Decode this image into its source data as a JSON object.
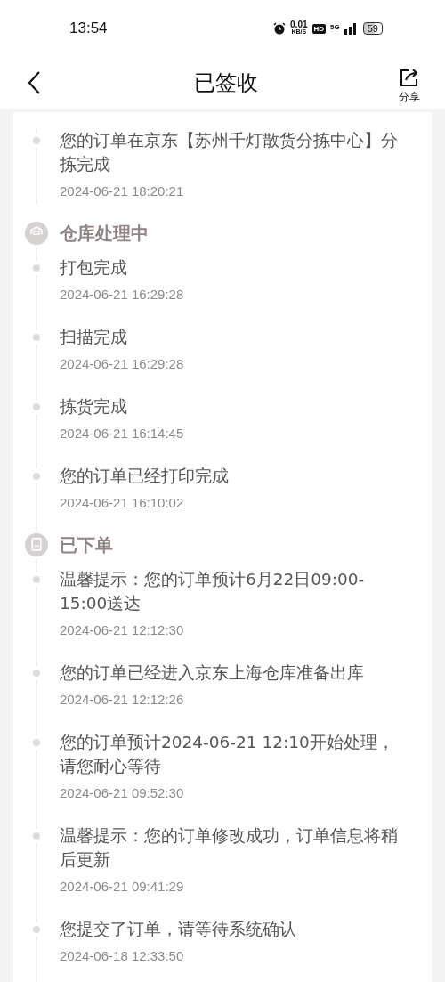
{
  "status_bar": {
    "time": "13:54",
    "speed": "0.01",
    "speed_unit": "KB/S",
    "hd": "HD",
    "network": "5G",
    "battery": "59"
  },
  "header": {
    "title": "已签收",
    "share_label": "分享"
  },
  "timeline": [
    {
      "kind": "event",
      "text": "您的订单在京东【苏州千灯散货分拣中心】分拣完成",
      "time": "2024-06-21 18:20:21"
    },
    {
      "kind": "stage",
      "title": "仓库处理中"
    },
    {
      "kind": "event",
      "text": "打包完成",
      "time": "2024-06-21 16:29:28"
    },
    {
      "kind": "event",
      "text": "扫描完成",
      "time": "2024-06-21 16:29:28"
    },
    {
      "kind": "event",
      "text": "拣货完成",
      "time": "2024-06-21 16:14:45"
    },
    {
      "kind": "event",
      "text": "您的订单已经打印完成",
      "time": "2024-06-21 16:10:02"
    },
    {
      "kind": "stage",
      "title": "已下单"
    },
    {
      "kind": "event",
      "text": "温馨提示：您的订单预计6月22日09:00-15:00送达",
      "time": "2024-06-21 12:12:30"
    },
    {
      "kind": "event",
      "text": "您的订单已经进入京东上海仓库准备出库",
      "time": "2024-06-21 12:12:26"
    },
    {
      "kind": "event",
      "text": "您的订单预计2024-06-21 12:10开始处理，请您耐心等待",
      "time": "2024-06-21 09:52:30"
    },
    {
      "kind": "event",
      "text": "温馨提示：您的订单修改成功，订单信息将稍后更新",
      "time": "2024-06-21 09:41:29"
    },
    {
      "kind": "event",
      "text": "您提交了订单，请等待系统确认",
      "time": "2024-06-18 12:33:50"
    }
  ]
}
